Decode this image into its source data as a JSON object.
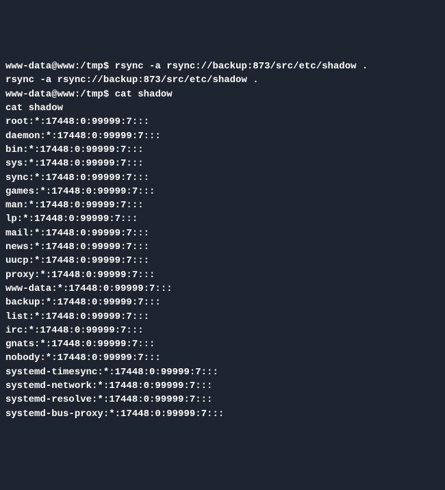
{
  "terminal": {
    "lines": [
      {
        "prompt": "www-data@www:/tmp$ ",
        "text": "rsync -a rsync://backup:873/src/etc/shadow ."
      },
      {
        "prompt": "",
        "text": "rsync -a rsync://backup:873/src/etc/shadow ."
      },
      {
        "prompt": "www-data@www:/tmp$ ",
        "text": "cat shadow"
      },
      {
        "prompt": "",
        "text": "cat shadow"
      },
      {
        "prompt": "",
        "text": "root:*:17448:0:99999:7:::"
      },
      {
        "prompt": "",
        "text": "daemon:*:17448:0:99999:7:::"
      },
      {
        "prompt": "",
        "text": "bin:*:17448:0:99999:7:::"
      },
      {
        "prompt": "",
        "text": "sys:*:17448:0:99999:7:::"
      },
      {
        "prompt": "",
        "text": "sync:*:17448:0:99999:7:::"
      },
      {
        "prompt": "",
        "text": "games:*:17448:0:99999:7:::"
      },
      {
        "prompt": "",
        "text": "man:*:17448:0:99999:7:::"
      },
      {
        "prompt": "",
        "text": "lp:*:17448:0:99999:7:::"
      },
      {
        "prompt": "",
        "text": "mail:*:17448:0:99999:7:::"
      },
      {
        "prompt": "",
        "text": "news:*:17448:0:99999:7:::"
      },
      {
        "prompt": "",
        "text": "uucp:*:17448:0:99999:7:::"
      },
      {
        "prompt": "",
        "text": "proxy:*:17448:0:99999:7:::"
      },
      {
        "prompt": "",
        "text": "www-data:*:17448:0:99999:7:::"
      },
      {
        "prompt": "",
        "text": "backup:*:17448:0:99999:7:::"
      },
      {
        "prompt": "",
        "text": "list:*:17448:0:99999:7:::"
      },
      {
        "prompt": "",
        "text": "irc:*:17448:0:99999:7:::"
      },
      {
        "prompt": "",
        "text": "gnats:*:17448:0:99999:7:::"
      },
      {
        "prompt": "",
        "text": "nobody:*:17448:0:99999:7:::"
      },
      {
        "prompt": "",
        "text": "systemd-timesync:*:17448:0:99999:7:::"
      },
      {
        "prompt": "",
        "text": "systemd-network:*:17448:0:99999:7:::"
      },
      {
        "prompt": "",
        "text": "systemd-resolve:*:17448:0:99999:7:::"
      },
      {
        "prompt": "",
        "text": "systemd-bus-proxy:*:17448:0:99999:7:::"
      }
    ]
  }
}
